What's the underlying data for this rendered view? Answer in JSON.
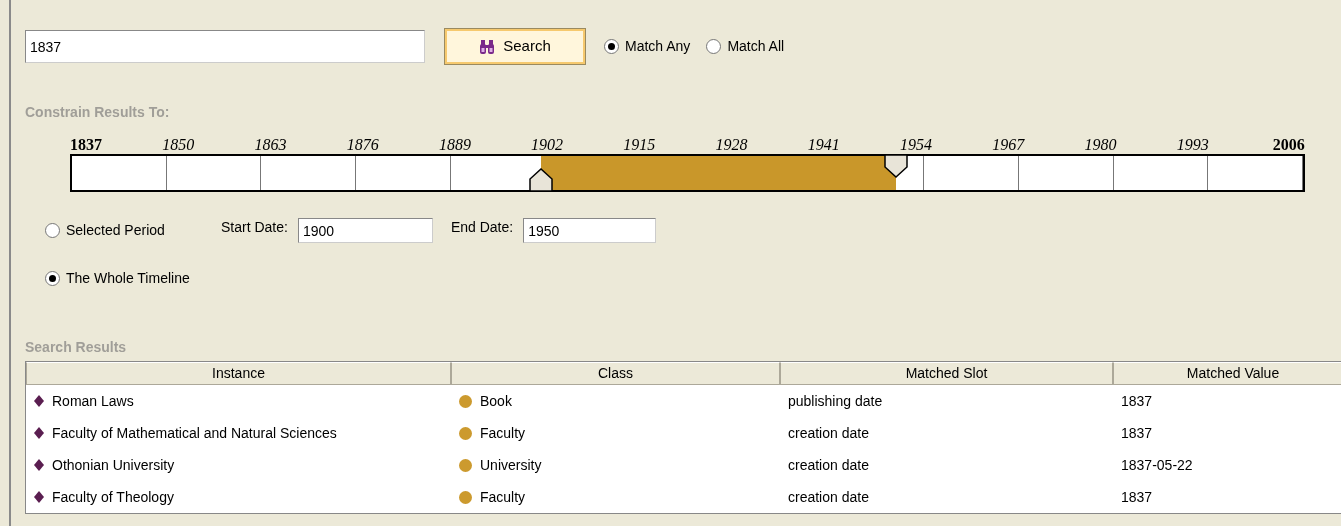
{
  "search": {
    "value": "1837",
    "button": "Search"
  },
  "match_modes": [
    {
      "label": "Match Any",
      "selected": true
    },
    {
      "label": "Match All",
      "selected": false
    }
  ],
  "constrain": {
    "heading": "Constrain Results To:",
    "timeline": {
      "labels": [
        {
          "text": "1837",
          "kind": "end"
        },
        {
          "text": "1850",
          "kind": "tick"
        },
        {
          "text": "1863",
          "kind": "tick"
        },
        {
          "text": "1876",
          "kind": "tick"
        },
        {
          "text": "1889",
          "kind": "tick"
        },
        {
          "text": "1902",
          "kind": "tick"
        },
        {
          "text": "1915",
          "kind": "tick"
        },
        {
          "text": "1928",
          "kind": "tick"
        },
        {
          "text": "1941",
          "kind": "tick"
        },
        {
          "text": "1954",
          "kind": "tick"
        },
        {
          "text": "1967",
          "kind": "tick"
        },
        {
          "text": "1980",
          "kind": "tick"
        },
        {
          "text": "1993",
          "kind": "tick"
        },
        {
          "text": "2006",
          "kind": "end"
        }
      ],
      "selection_start": {
        "level": 0.381
      },
      "selection_end": {
        "level": 0.669
      }
    },
    "options": [
      {
        "label": "Selected Period",
        "selected": false
      },
      {
        "label": "The Whole Timeline",
        "selected": true
      }
    ],
    "start_date": {
      "label": "Start Date:",
      "value": "1900"
    },
    "end_date": {
      "label": "End Date:",
      "value": "1950"
    }
  },
  "results": {
    "heading": "Search Results",
    "columns": [
      "Instance",
      "Class",
      "Matched Slot",
      "Matched Value"
    ],
    "rows": [
      {
        "instance": "Roman Laws",
        "class": "Book",
        "slot": "publishing date",
        "value": "1837"
      },
      {
        "instance": "Faculty of Mathematical and Natural Sciences",
        "class": "Faculty",
        "slot": "creation date",
        "value": "1837"
      },
      {
        "instance": "Othonian University",
        "class": "University",
        "slot": "creation date",
        "value": "1837-05-22"
      },
      {
        "instance": "Faculty of Theology",
        "class": "Faculty",
        "slot": "creation date",
        "value": "1837"
      }
    ]
  }
}
